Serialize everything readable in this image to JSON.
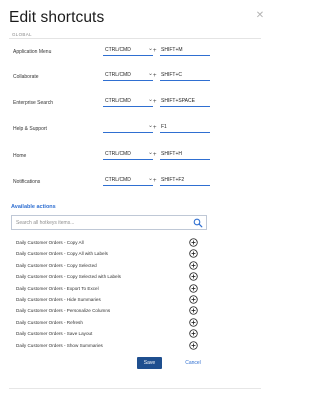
{
  "dialog": {
    "title": "Edit shortcuts",
    "close_icon": "close-icon"
  },
  "global_section": {
    "label": "GLOBAL",
    "rows": [
      {
        "label": "Application Menu",
        "modifier": "CTRL/CMD",
        "key": "SHIFT+M"
      },
      {
        "label": "Collaborate",
        "modifier": "CTRL/CMD",
        "key": "SHIFT+C"
      },
      {
        "label": "Enterprise Search",
        "modifier": "CTRL/CMD",
        "key": "SHIFT+SPACE"
      },
      {
        "label": "Help & Support",
        "modifier": "",
        "key": "F1"
      },
      {
        "label": "Home",
        "modifier": "CTRL/CMD",
        "key": "SHIFT+H"
      },
      {
        "label": "Notifications",
        "modifier": "CTRL/CMD",
        "key": "SHIFT+F2"
      }
    ]
  },
  "available": {
    "title": "Available actions",
    "search_placeholder": "Search all hotkeys items...",
    "search_icon": "search-icon",
    "items": [
      "Daily Customer Orders - Copy All",
      "Daily Customer Orders - Copy All with Labels",
      "Daily Customer Orders - Copy Selected",
      "Daily Customer Orders - Copy Selected with Labels",
      "Daily Customer Orders - Export To Excel",
      "Daily Customer Orders - Hide Summaries",
      "Daily Customer Orders - Personalize Columns",
      "Daily Customer Orders - Refresh",
      "Daily Customer Orders - Save Layout",
      "Daily Customer Orders - Show Summaries"
    ]
  },
  "footer": {
    "save_label": "Save",
    "cancel_label": "Cancel"
  },
  "colors": {
    "accent": "#2f6fd1",
    "primary_button": "#1f4f8f"
  }
}
